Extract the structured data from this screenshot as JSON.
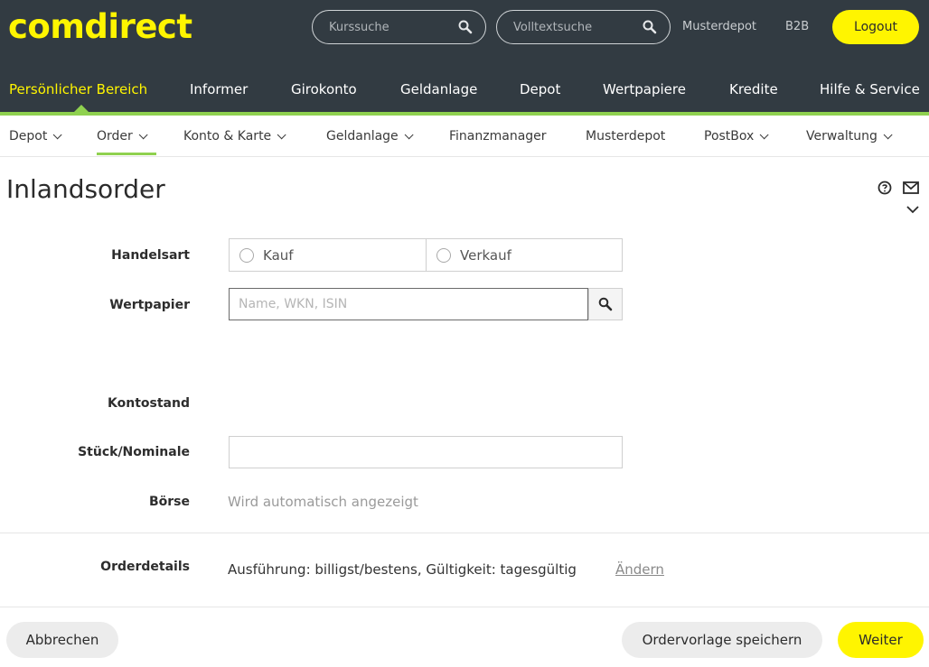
{
  "header": {
    "logo": "comdirect",
    "search_kurs_placeholder": "Kurssuche",
    "search_volltext_placeholder": "Volltextsuche",
    "link_musterdepot": "Musterdepot",
    "link_b2b": "B2B",
    "logout_label": "Logout"
  },
  "main_nav": [
    {
      "label": "Persönlicher Bereich",
      "active": true
    },
    {
      "label": "Informer"
    },
    {
      "label": "Girokonto"
    },
    {
      "label": "Geldanlage"
    },
    {
      "label": "Depot"
    },
    {
      "label": "Wertpapiere"
    },
    {
      "label": "Kredite"
    },
    {
      "label": "Hilfe & Service"
    }
  ],
  "sub_nav": [
    {
      "label": "Depot"
    },
    {
      "label": "Order",
      "active": true
    },
    {
      "label": "Konto & Karte"
    },
    {
      "label": "Geldanlage"
    },
    {
      "label": "Finanzmanager"
    },
    {
      "label": "Musterdepot"
    },
    {
      "label": "PostBox"
    },
    {
      "label": "Verwaltung"
    }
  ],
  "page": {
    "title": "Inlandsorder"
  },
  "form": {
    "handelsart_label": "Handelsart",
    "kauf_label": "Kauf",
    "verkauf_label": "Verkauf",
    "wertpapier_label": "Wertpapier",
    "wertpapier_placeholder": "Name, WKN, ISIN",
    "kontostand_label": "Kontostand",
    "stueck_label": "Stück/Nominale",
    "boerse_label": "Börse",
    "boerse_value": "Wird automatisch angezeigt",
    "orderdetails_label": "Orderdetails",
    "orderdetails_value": "Ausführung: billigst/bestens, Gültigkeit: tagesgültig",
    "aendern_label": "Ändern"
  },
  "actions": {
    "cancel_label": "Abbrechen",
    "save_template_label": "Ordervorlage speichern",
    "next_label": "Weiter"
  },
  "colors": {
    "brand_yellow": "#fff500",
    "header_bg": "#323b42",
    "accent_green": "#8fd14f"
  }
}
